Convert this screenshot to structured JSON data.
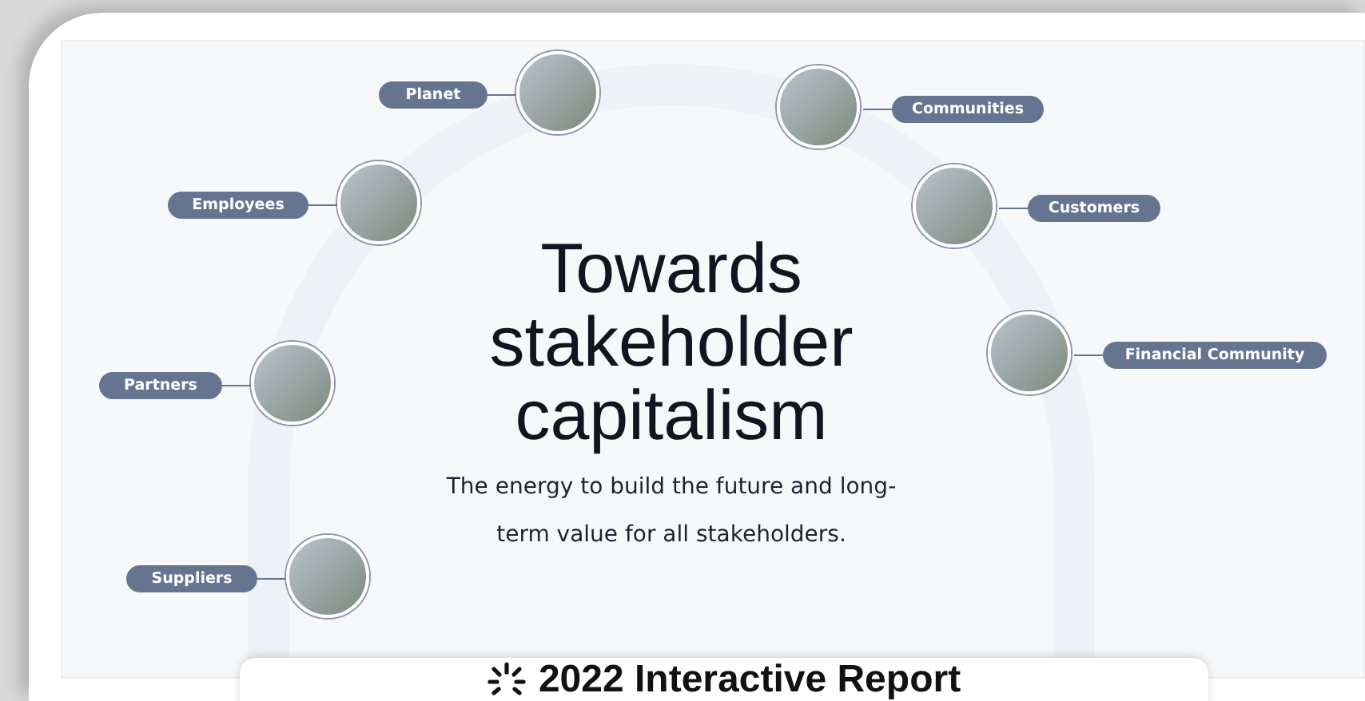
{
  "diagram": {
    "title_lines": [
      "Towards",
      "stakeholder",
      "capitalism"
    ],
    "subtitle_lines": [
      "The energy to build the future and long-",
      "term value for all stakeholders."
    ],
    "stakeholders": [
      {
        "label": "Planet",
        "kind": "label-left"
      },
      {
        "label": "Communities",
        "kind": "label-right"
      },
      {
        "label": "Employees",
        "kind": "label-left"
      },
      {
        "label": "Customers",
        "kind": "label-right"
      },
      {
        "label": "Partners",
        "kind": "label-left"
      },
      {
        "label": "Financial Community",
        "kind": "label-right"
      },
      {
        "label": "Suppliers",
        "kind": "label-left"
      }
    ]
  },
  "report_banner": {
    "title": "2022 Interactive Report"
  }
}
